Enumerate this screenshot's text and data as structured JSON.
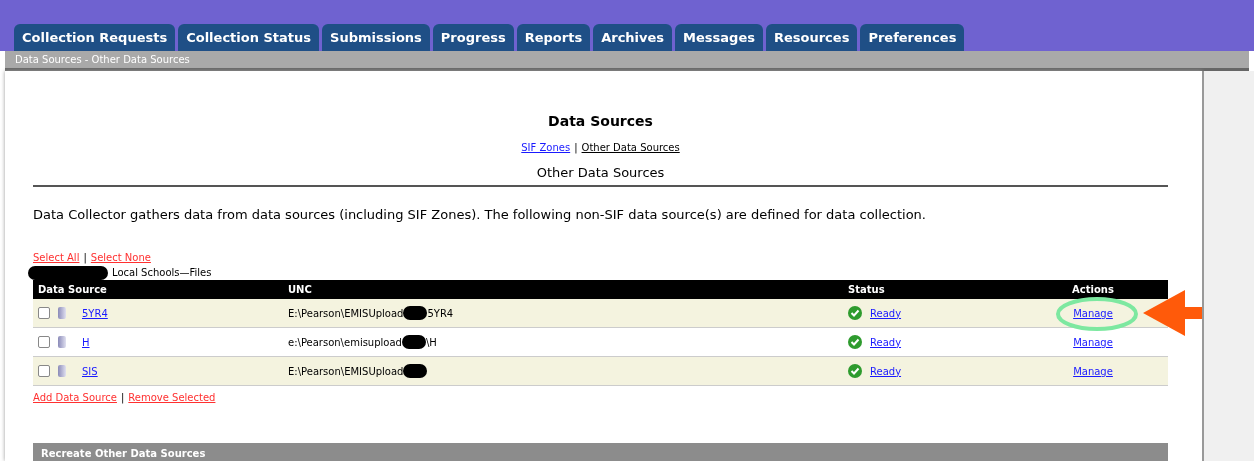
{
  "tabs": [
    {
      "label": "Collection Requests",
      "selected": false
    },
    {
      "label": "Collection Status",
      "selected": false
    },
    {
      "label": "Submissions",
      "selected": false
    },
    {
      "label": "Progress",
      "selected": false
    },
    {
      "label": "Reports",
      "selected": false
    },
    {
      "label": "Archives",
      "selected": false
    },
    {
      "label": "Messages",
      "selected": false
    },
    {
      "label": "Resources",
      "selected": false
    },
    {
      "label": "Preferences",
      "selected": false
    }
  ],
  "breadcrumb": "Data Sources - Other Data Sources",
  "page_title": "Data Sources",
  "subnav": [
    {
      "label": "SIF Zones",
      "selected": false
    },
    {
      "label": "Other Data Sources",
      "selected": true
    }
  ],
  "section_title": "Other Data Sources",
  "description": "Data Collector gathers data from data sources (including SIF Zones). The following non-SIF data source(s) are defined for data collection.",
  "link_separator": "|",
  "select_links": [
    "Select All",
    "Select None"
  ],
  "group_label": "Local Schools—Files",
  "table": {
    "columns": [
      "Data Source",
      "UNC",
      "Status",
      "Actions"
    ],
    "rows": [
      {
        "checked": false,
        "name": "5YR4",
        "unc_before": "E:\\Pearson\\EMISUpload",
        "unc_after": "5YR4",
        "status": "Ready",
        "action": "Manage",
        "highlighted": true
      },
      {
        "checked": false,
        "name": "H",
        "unc_before": "e:\\Pearson\\emisupload",
        "unc_after": "\\H",
        "status": "Ready",
        "action": "Manage",
        "highlighted": false
      },
      {
        "checked": false,
        "name": "SIS",
        "unc_before": "E:\\Pearson\\EMISUpload",
        "unc_after": "",
        "status": "Ready",
        "action": "Manage",
        "highlighted": false
      }
    ]
  },
  "bottom_links": [
    "Add Data Source",
    "Remove Selected"
  ],
  "next_section": "Recreate Other Data Sources"
}
